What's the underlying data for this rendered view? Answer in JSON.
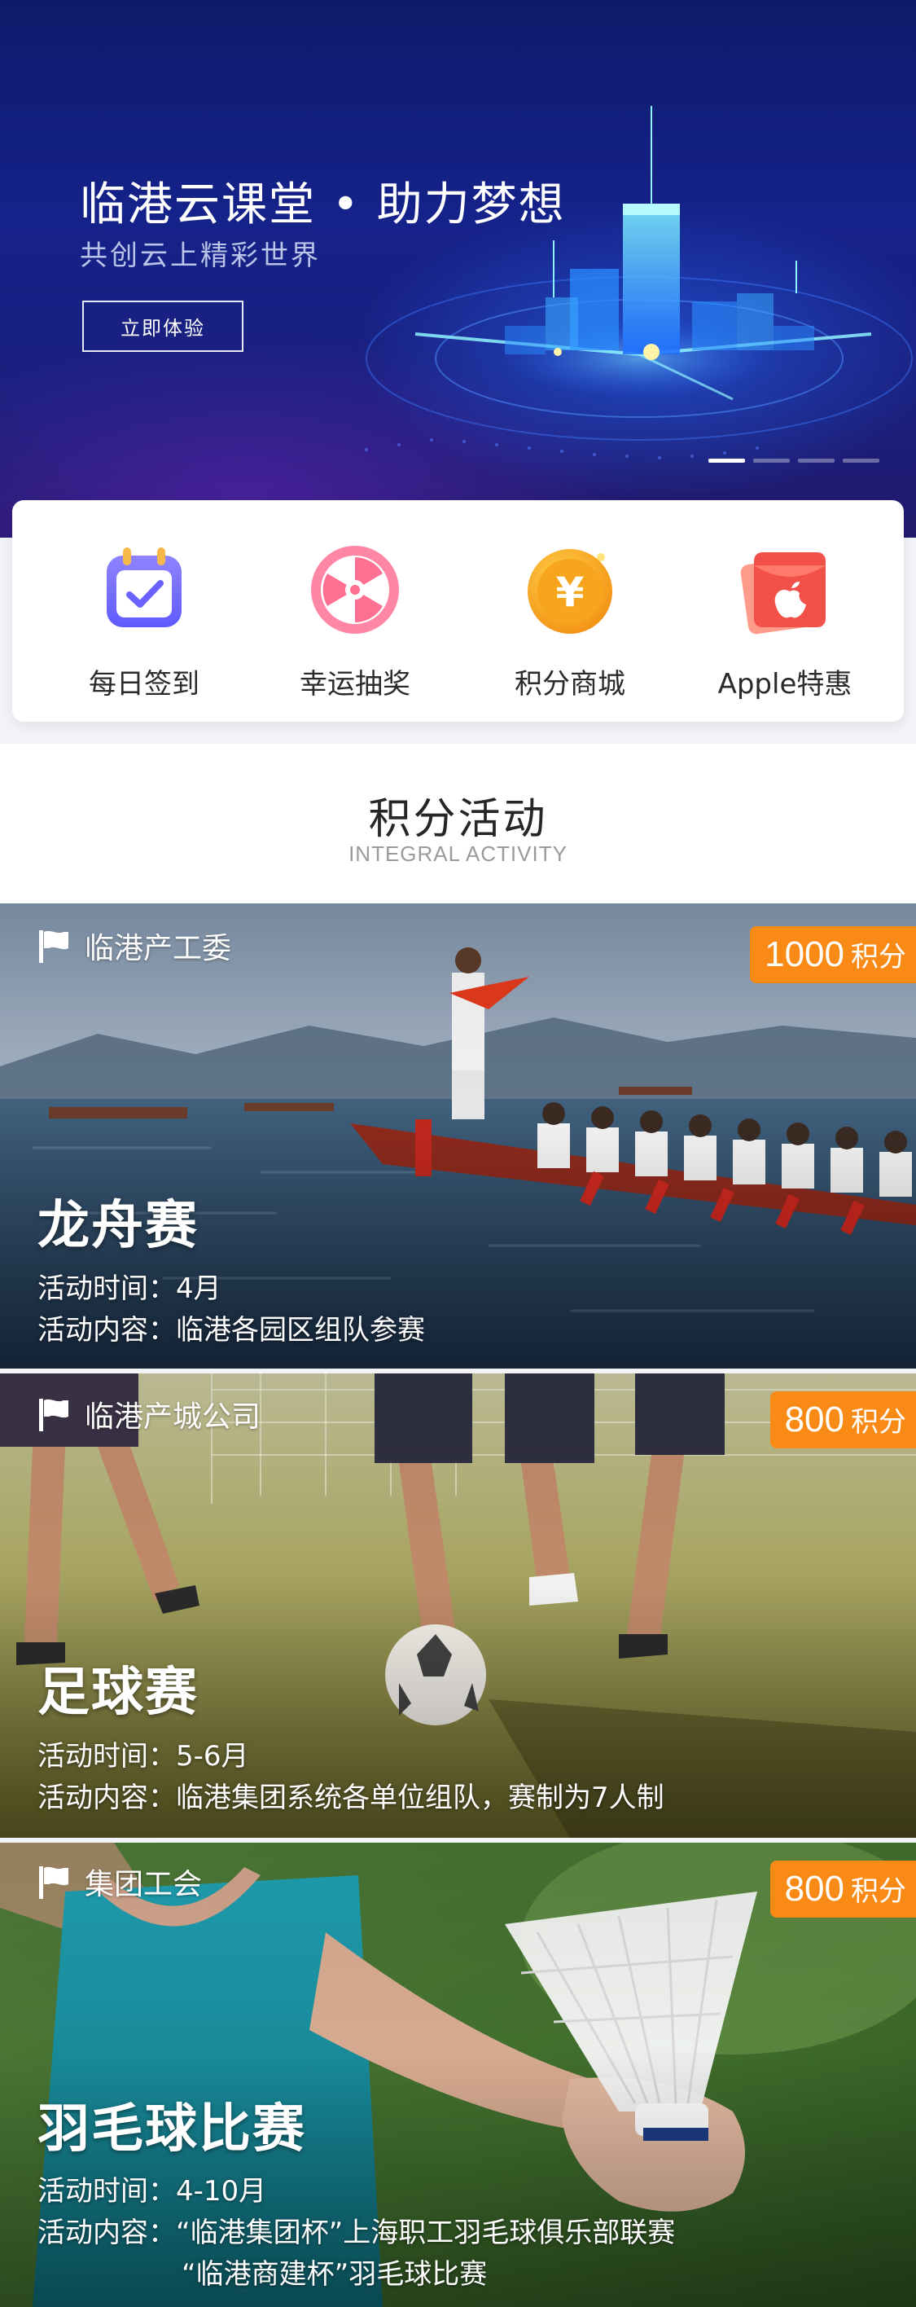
{
  "banner": {
    "title": "临港云课堂 • 助力梦想",
    "subtitle": "共创云上精彩世界",
    "cta_label": "立即体验",
    "slides_total": 4,
    "slide_active": 1
  },
  "menu": {
    "items": [
      {
        "label": "每日签到",
        "icon": "calendar-check-icon"
      },
      {
        "label": "幸运抽奖",
        "icon": "lucky-wheel-icon"
      },
      {
        "label": "积分商城",
        "icon": "yen-coin-icon"
      },
      {
        "label": "Apple特惠",
        "icon": "apple-red-envelope-icon"
      }
    ]
  },
  "section": {
    "title": "积分活动",
    "subtitle": "INTEGRAL ACTIVITY"
  },
  "activities": [
    {
      "org": "临港产工委",
      "points_value": "1000",
      "points_unit": "积分",
      "title": "龙舟赛",
      "time": "活动时间：4月",
      "content": "活动内容：临港各园区组队参赛"
    },
    {
      "org": "临港产城公司",
      "points_value": "800",
      "points_unit": "积分",
      "title": "足球赛",
      "time": "活动时间：5-6月",
      "content": "活动内容：临港集团系统各单位组队，赛制为7人制"
    },
    {
      "org": "集团工会",
      "points_value": "800",
      "points_unit": "积分",
      "title": "羽毛球比赛",
      "time": "活动时间：4-10月",
      "content": "活动内容：“临港集团杯”上海职工羽毛球俱乐部联赛",
      "content_line2": "“临港商建杯”羽毛球比赛"
    }
  ],
  "colors": {
    "points_badge": "#f98a16",
    "banner_bg": "#15228a"
  }
}
